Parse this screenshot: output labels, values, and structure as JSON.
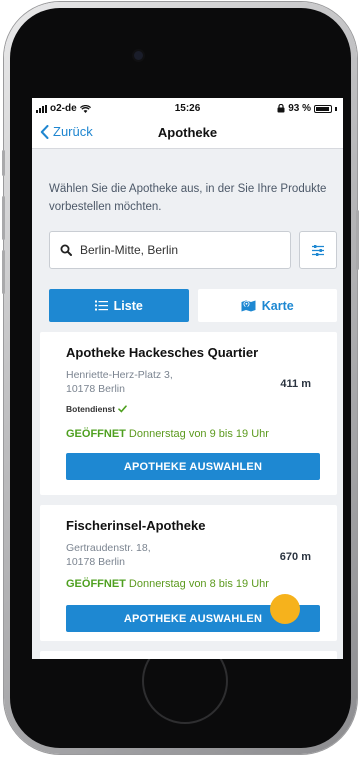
{
  "status_bar": {
    "carrier": "o2-de",
    "time": "15:26",
    "battery": "93 %"
  },
  "nav": {
    "back_label": "Zurück",
    "title": "Apotheke"
  },
  "intro_text": "Wählen Sie die Apotheke aus, in der Sie Ihre Produkte vorbestellen möchten.",
  "search": {
    "value": "Berlin-Mitte, Berlin",
    "placeholder": "Berlin-Mitte, Berlin"
  },
  "tabs": [
    {
      "label": "Liste",
      "active": true
    },
    {
      "label": "Karte",
      "active": false
    }
  ],
  "pharmacies": [
    {
      "name": "Apotheke Hackesches Quartier",
      "address_line1": "Henriette-Herz-Platz 3,",
      "address_line2": "10178 Berlin",
      "distance": "411 m",
      "service": "Botendienst",
      "open_label": "GEÖFFNET",
      "hours": "Donnerstag von 9 bis 19 Uhr",
      "button_label": "APOTHEKE AUSWAHLEN"
    },
    {
      "name": "Fischerinsel-Apotheke",
      "address_line1": "Gertraudenstr. 18,",
      "address_line2": "10178 Berlin",
      "distance": "670 m",
      "open_label": "GEÖFFNET",
      "hours": "Donnerstag von 8 bis 19 Uhr",
      "button_label": "APOTHEKE AUSWAHLEN"
    }
  ],
  "colors": {
    "accent": "#1e88d2",
    "open_green": "#4fa020",
    "tap_indicator": "#f6b21c"
  }
}
